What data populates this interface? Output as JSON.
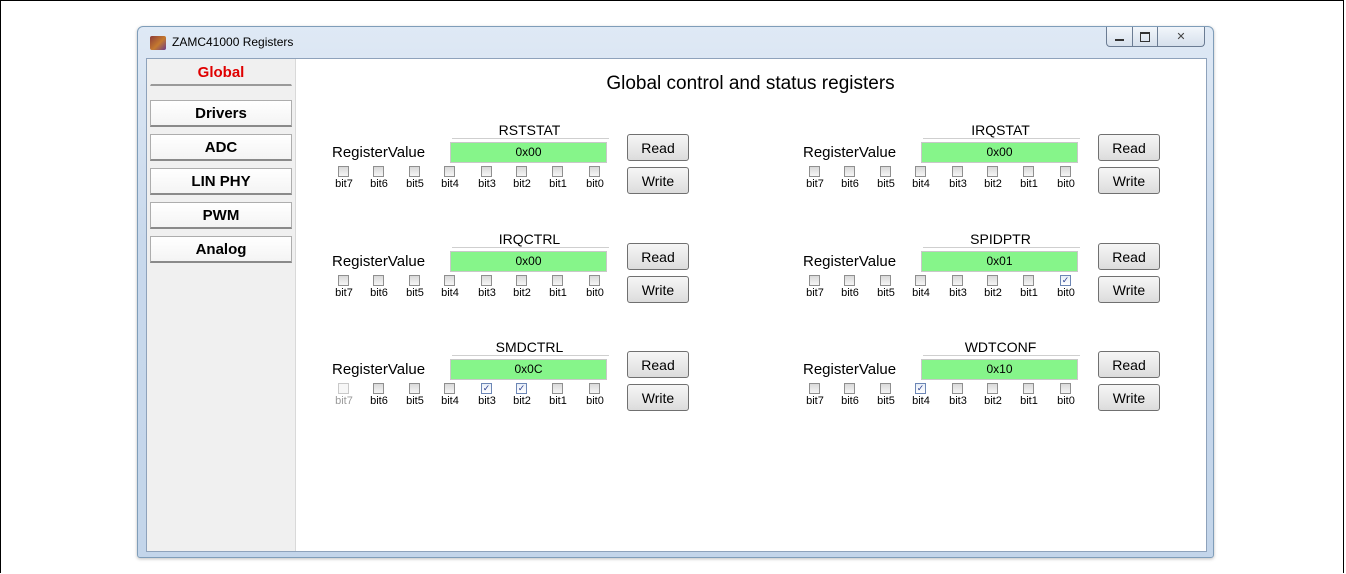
{
  "window": {
    "title": "ZAMC41000 Registers",
    "controls": {
      "minimize": "minimize-icon",
      "maximize": "maximize-icon",
      "close_glyph": "✕"
    }
  },
  "sidebar": {
    "items": [
      {
        "label": "Global",
        "active": true
      },
      {
        "label": "Drivers",
        "active": false
      },
      {
        "label": "ADC",
        "active": false
      },
      {
        "label": "LIN PHY",
        "active": false
      },
      {
        "label": "PWM",
        "active": false
      },
      {
        "label": "Analog",
        "active": false
      }
    ]
  },
  "main": {
    "title": "Global control and status registers",
    "value_label": "RegisterValue",
    "read_label": "Read",
    "write_label": "Write",
    "bit_labels": [
      "bit7",
      "bit6",
      "bit5",
      "bit4",
      "bit3",
      "bit2",
      "bit1",
      "bit0"
    ],
    "registers": [
      {
        "name": "RSTSTAT",
        "value": "0x00",
        "checked": [
          false,
          false,
          false,
          false,
          false,
          false,
          false,
          false
        ],
        "disabled": [
          false,
          false,
          false,
          false,
          false,
          false,
          false,
          false
        ]
      },
      {
        "name": "IRQSTAT",
        "value": "0x00",
        "checked": [
          false,
          false,
          false,
          false,
          false,
          false,
          false,
          false
        ],
        "disabled": [
          false,
          false,
          false,
          false,
          false,
          false,
          false,
          false
        ]
      },
      {
        "name": "IRQCTRL",
        "value": "0x00",
        "checked": [
          false,
          false,
          false,
          false,
          false,
          false,
          false,
          false
        ],
        "disabled": [
          false,
          false,
          false,
          false,
          false,
          false,
          false,
          false
        ]
      },
      {
        "name": "SPIDPTR",
        "value": "0x01",
        "checked": [
          false,
          false,
          false,
          false,
          false,
          false,
          false,
          true
        ],
        "disabled": [
          false,
          false,
          false,
          false,
          false,
          false,
          false,
          false
        ]
      },
      {
        "name": "SMDCTRL",
        "value": "0x0C",
        "checked": [
          false,
          false,
          false,
          false,
          true,
          true,
          false,
          false
        ],
        "disabled": [
          true,
          false,
          false,
          false,
          false,
          false,
          false,
          false
        ]
      },
      {
        "name": "WDTCONF",
        "value": "0x10",
        "checked": [
          false,
          false,
          false,
          true,
          false,
          false,
          false,
          false
        ],
        "disabled": [
          false,
          false,
          false,
          false,
          false,
          false,
          false,
          false
        ]
      }
    ]
  },
  "colors": {
    "value_bg": "#86f58a",
    "active_tab_text": "#e00000"
  }
}
